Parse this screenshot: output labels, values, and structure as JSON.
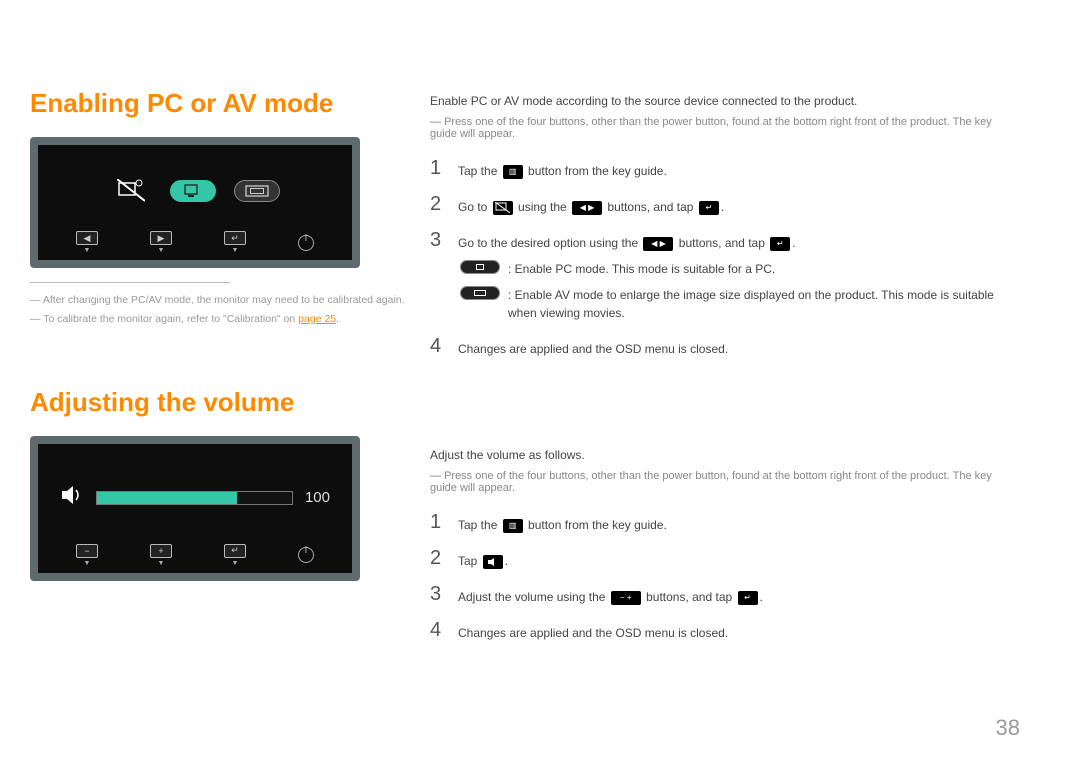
{
  "page_number": "38",
  "section1": {
    "title": "Enabling PC or AV mode",
    "footnote1": "After changing the PC/AV mode, the monitor may need to be calibrated again.",
    "footnote2_prefix": "To calibrate the monitor again, refer to \"Calibration\" on ",
    "footnote2_link": "page 25",
    "footnote2_suffix": ".",
    "intro": "Enable PC or AV mode according to the source device connected to the product.",
    "intro_note": "Press one of the four buttons, other than the power button, found at the bottom right front of the product. The key guide will appear.",
    "steps": {
      "s1_a": "Tap the ",
      "s1_b": " button from the key guide.",
      "s2_a": "Go to ",
      "s2_b": " using the ",
      "s2_c": " buttons, and tap ",
      "s2_d": ".",
      "s3_a": "Go to the desired option using the ",
      "s3_b": " buttons, and tap ",
      "s3_c": ".",
      "s3_pc": " : Enable PC mode. This mode is suitable for a PC.",
      "s3_av": " : Enable AV mode to enlarge the image size displayed on the product. This mode is suitable when viewing movies.",
      "s4": "Changes are applied and the OSD menu is closed."
    }
  },
  "section2": {
    "title": "Adjusting the volume",
    "volume_value": "100",
    "intro": "Adjust the volume as follows.",
    "intro_note": "Press one of the four buttons, other than the power button, found at the bottom right front of the product. The key guide will appear.",
    "steps": {
      "s1_a": "Tap the ",
      "s1_b": " button from the key guide.",
      "s2_a": "Tap ",
      "s2_b": ".",
      "s3_a": "Adjust the volume using the ",
      "s3_b": " buttons, and tap ",
      "s3_c": ".",
      "s4": "Changes are applied and the OSD menu is closed."
    }
  }
}
